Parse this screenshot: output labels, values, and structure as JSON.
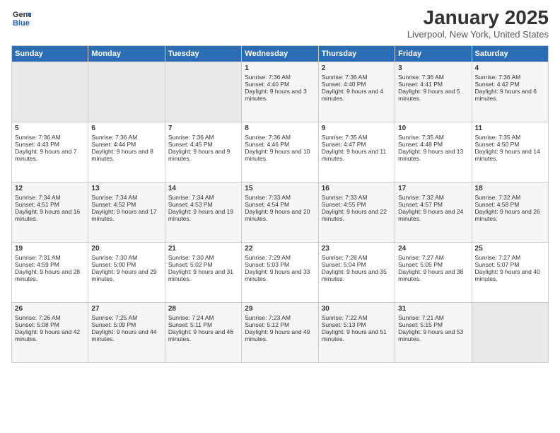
{
  "header": {
    "logo_general": "General",
    "logo_blue": "Blue",
    "title": "January 2025",
    "subtitle": "Liverpool, New York, United States"
  },
  "days_of_week": [
    "Sunday",
    "Monday",
    "Tuesday",
    "Wednesday",
    "Thursday",
    "Friday",
    "Saturday"
  ],
  "weeks": [
    [
      {
        "day": "",
        "sunrise": "",
        "sunset": "",
        "daylight": "",
        "empty": true
      },
      {
        "day": "",
        "sunrise": "",
        "sunset": "",
        "daylight": "",
        "empty": true
      },
      {
        "day": "",
        "sunrise": "",
        "sunset": "",
        "daylight": "",
        "empty": true
      },
      {
        "day": "1",
        "sunrise": "Sunrise: 7:36 AM",
        "sunset": "Sunset: 4:40 PM",
        "daylight": "Daylight: 9 hours and 3 minutes."
      },
      {
        "day": "2",
        "sunrise": "Sunrise: 7:36 AM",
        "sunset": "Sunset: 4:40 PM",
        "daylight": "Daylight: 9 hours and 4 minutes."
      },
      {
        "day": "3",
        "sunrise": "Sunrise: 7:36 AM",
        "sunset": "Sunset: 4:41 PM",
        "daylight": "Daylight: 9 hours and 5 minutes."
      },
      {
        "day": "4",
        "sunrise": "Sunrise: 7:36 AM",
        "sunset": "Sunset: 4:42 PM",
        "daylight": "Daylight: 9 hours and 6 minutes."
      }
    ],
    [
      {
        "day": "5",
        "sunrise": "Sunrise: 7:36 AM",
        "sunset": "Sunset: 4:43 PM",
        "daylight": "Daylight: 9 hours and 7 minutes."
      },
      {
        "day": "6",
        "sunrise": "Sunrise: 7:36 AM",
        "sunset": "Sunset: 4:44 PM",
        "daylight": "Daylight: 9 hours and 8 minutes."
      },
      {
        "day": "7",
        "sunrise": "Sunrise: 7:36 AM",
        "sunset": "Sunset: 4:45 PM",
        "daylight": "Daylight: 9 hours and 9 minutes."
      },
      {
        "day": "8",
        "sunrise": "Sunrise: 7:36 AM",
        "sunset": "Sunset: 4:46 PM",
        "daylight": "Daylight: 9 hours and 10 minutes."
      },
      {
        "day": "9",
        "sunrise": "Sunrise: 7:35 AM",
        "sunset": "Sunset: 4:47 PM",
        "daylight": "Daylight: 9 hours and 11 minutes."
      },
      {
        "day": "10",
        "sunrise": "Sunrise: 7:35 AM",
        "sunset": "Sunset: 4:48 PM",
        "daylight": "Daylight: 9 hours and 13 minutes."
      },
      {
        "day": "11",
        "sunrise": "Sunrise: 7:35 AM",
        "sunset": "Sunset: 4:50 PM",
        "daylight": "Daylight: 9 hours and 14 minutes."
      }
    ],
    [
      {
        "day": "12",
        "sunrise": "Sunrise: 7:34 AM",
        "sunset": "Sunset: 4:51 PM",
        "daylight": "Daylight: 9 hours and 16 minutes."
      },
      {
        "day": "13",
        "sunrise": "Sunrise: 7:34 AM",
        "sunset": "Sunset: 4:52 PM",
        "daylight": "Daylight: 9 hours and 17 minutes."
      },
      {
        "day": "14",
        "sunrise": "Sunrise: 7:34 AM",
        "sunset": "Sunset: 4:53 PM",
        "daylight": "Daylight: 9 hours and 19 minutes."
      },
      {
        "day": "15",
        "sunrise": "Sunrise: 7:33 AM",
        "sunset": "Sunset: 4:54 PM",
        "daylight": "Daylight: 9 hours and 20 minutes."
      },
      {
        "day": "16",
        "sunrise": "Sunrise: 7:33 AM",
        "sunset": "Sunset: 4:55 PM",
        "daylight": "Daylight: 9 hours and 22 minutes."
      },
      {
        "day": "17",
        "sunrise": "Sunrise: 7:32 AM",
        "sunset": "Sunset: 4:57 PM",
        "daylight": "Daylight: 9 hours and 24 minutes."
      },
      {
        "day": "18",
        "sunrise": "Sunrise: 7:32 AM",
        "sunset": "Sunset: 4:58 PM",
        "daylight": "Daylight: 9 hours and 26 minutes."
      }
    ],
    [
      {
        "day": "19",
        "sunrise": "Sunrise: 7:31 AM",
        "sunset": "Sunset: 4:59 PM",
        "daylight": "Daylight: 9 hours and 28 minutes."
      },
      {
        "day": "20",
        "sunrise": "Sunrise: 7:30 AM",
        "sunset": "Sunset: 5:00 PM",
        "daylight": "Daylight: 9 hours and 29 minutes."
      },
      {
        "day": "21",
        "sunrise": "Sunrise: 7:30 AM",
        "sunset": "Sunset: 5:02 PM",
        "daylight": "Daylight: 9 hours and 31 minutes."
      },
      {
        "day": "22",
        "sunrise": "Sunrise: 7:29 AM",
        "sunset": "Sunset: 5:03 PM",
        "daylight": "Daylight: 9 hours and 33 minutes."
      },
      {
        "day": "23",
        "sunrise": "Sunrise: 7:28 AM",
        "sunset": "Sunset: 5:04 PM",
        "daylight": "Daylight: 9 hours and 35 minutes."
      },
      {
        "day": "24",
        "sunrise": "Sunrise: 7:27 AM",
        "sunset": "Sunset: 5:05 PM",
        "daylight": "Daylight: 9 hours and 38 minutes."
      },
      {
        "day": "25",
        "sunrise": "Sunrise: 7:27 AM",
        "sunset": "Sunset: 5:07 PM",
        "daylight": "Daylight: 9 hours and 40 minutes."
      }
    ],
    [
      {
        "day": "26",
        "sunrise": "Sunrise: 7:26 AM",
        "sunset": "Sunset: 5:08 PM",
        "daylight": "Daylight: 9 hours and 42 minutes."
      },
      {
        "day": "27",
        "sunrise": "Sunrise: 7:25 AM",
        "sunset": "Sunset: 5:09 PM",
        "daylight": "Daylight: 9 hours and 44 minutes."
      },
      {
        "day": "28",
        "sunrise": "Sunrise: 7:24 AM",
        "sunset": "Sunset: 5:11 PM",
        "daylight": "Daylight: 9 hours and 46 minutes."
      },
      {
        "day": "29",
        "sunrise": "Sunrise: 7:23 AM",
        "sunset": "Sunset: 5:12 PM",
        "daylight": "Daylight: 9 hours and 49 minutes."
      },
      {
        "day": "30",
        "sunrise": "Sunrise: 7:22 AM",
        "sunset": "Sunset: 5:13 PM",
        "daylight": "Daylight: 9 hours and 51 minutes."
      },
      {
        "day": "31",
        "sunrise": "Sunrise: 7:21 AM",
        "sunset": "Sunset: 5:15 PM",
        "daylight": "Daylight: 9 hours and 53 minutes."
      },
      {
        "day": "",
        "sunrise": "",
        "sunset": "",
        "daylight": "",
        "empty": true
      }
    ]
  ]
}
